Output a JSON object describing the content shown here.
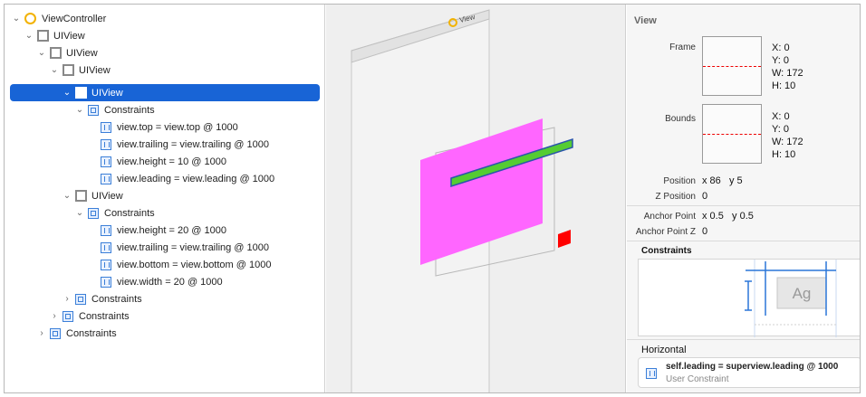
{
  "navigator": {
    "rows": [
      {
        "label": "ViewController"
      },
      {
        "label": "UIView"
      },
      {
        "label": "UIView"
      },
      {
        "label": "UIView"
      },
      {
        "label": "UIView"
      },
      {
        "label": "Constraints"
      },
      {
        "label": "view.top = view.top @ 1000"
      },
      {
        "label": "view.trailing = view.trailing @ 1000"
      },
      {
        "label": "view.height = 10 @ 1000"
      },
      {
        "label": "view.leading = view.leading @ 1000"
      },
      {
        "label": "UIView"
      },
      {
        "label": "Constraints"
      },
      {
        "label": "view.height = 20 @ 1000"
      },
      {
        "label": "view.trailing = view.trailing @ 1000"
      },
      {
        "label": "view.bottom = view.bottom @ 1000"
      },
      {
        "label": "view.width = 20 @ 1000"
      },
      {
        "label": "Constraints"
      },
      {
        "label": "Constraints"
      },
      {
        "label": "Constraints"
      }
    ]
  },
  "canvas": {
    "scene_label": "View",
    "colors": {
      "magenta": "#ff66ff",
      "green": "#55cc33",
      "red": "#ff0000"
    }
  },
  "inspector": {
    "title": "View",
    "frame": {
      "label": "Frame",
      "x": "X: 0",
      "y": "Y: 0",
      "w": "W: 172",
      "h": "H: 10"
    },
    "bounds": {
      "label": "Bounds",
      "x": "X: 0",
      "y": "Y: 0",
      "w": "W: 172",
      "h": "H: 10"
    },
    "position": {
      "label": "Position",
      "value": "x 86   y 5"
    },
    "z_position": {
      "label": "Z Position",
      "value": "0"
    },
    "anchor_point": {
      "label": "Anchor Point",
      "value": "x 0.5   y 0.5"
    },
    "anchor_point_z": {
      "label": "Anchor Point Z",
      "value": "0"
    },
    "constraints_header": "Constraints",
    "preview_text": "Ag",
    "horizontal_header": "Horizontal",
    "constraint_item": {
      "title": "self.leading = superview.leading @ 1000",
      "subtitle": "User Constraint"
    }
  }
}
